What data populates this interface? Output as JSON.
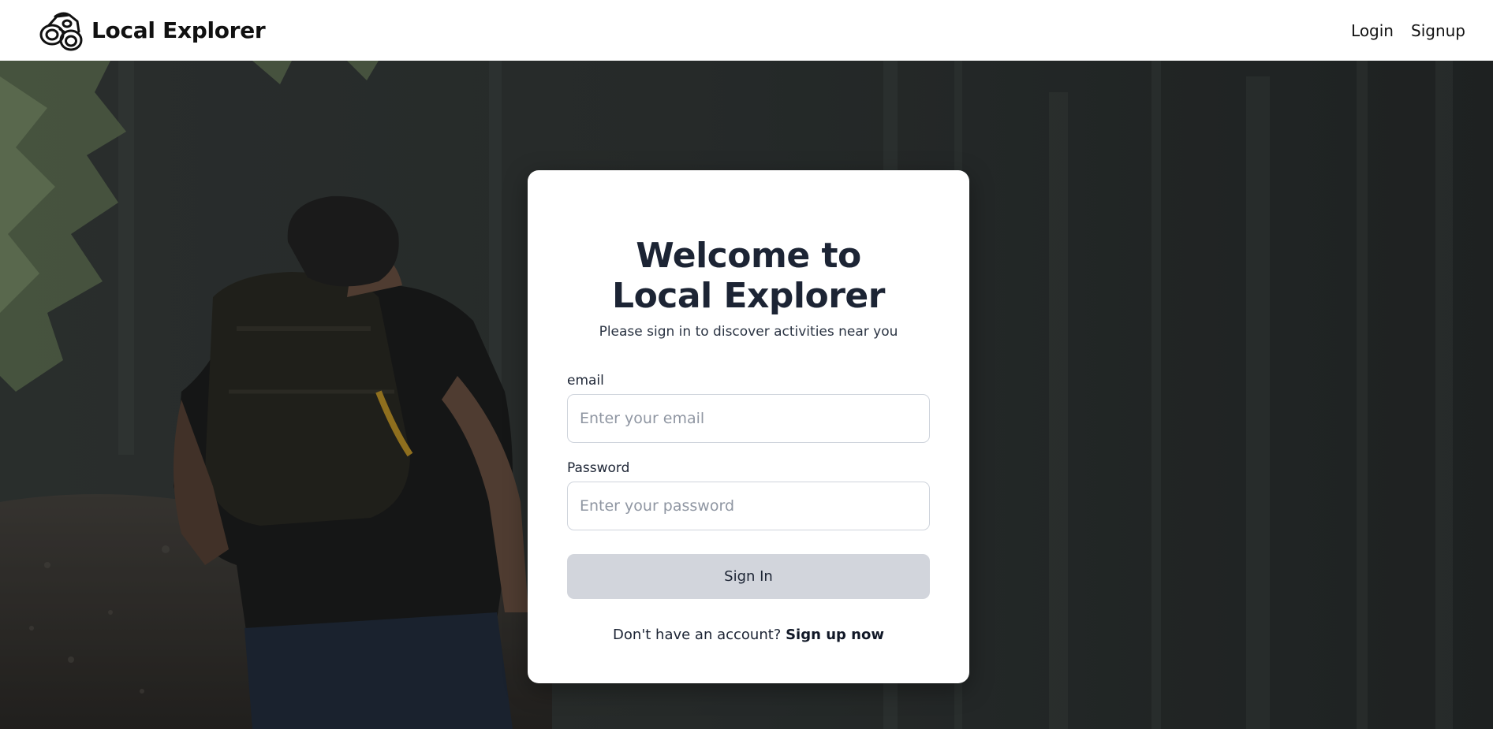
{
  "navbar": {
    "brand_name": "Local Explorer",
    "logo_icon": "binoculars-icon",
    "links": [
      {
        "label": "Login"
      },
      {
        "label": "Signup"
      }
    ]
  },
  "login_card": {
    "title": "Welcome to Local Explorer",
    "subtitle": "Please sign in to discover activities near you",
    "email_label": "email",
    "email_placeholder": "Enter your email",
    "email_value": "",
    "password_label": "Password",
    "password_placeholder": "Enter your password",
    "password_value": "",
    "signin_label": "Sign In",
    "signup_prompt": "Don't have an account?",
    "signup_link": "Sign up now"
  },
  "colors": {
    "title": "#1c2434",
    "button_bg": "#d2d5dc",
    "input_border": "#cfd4dc",
    "hero_overlay": "#2f3433"
  }
}
